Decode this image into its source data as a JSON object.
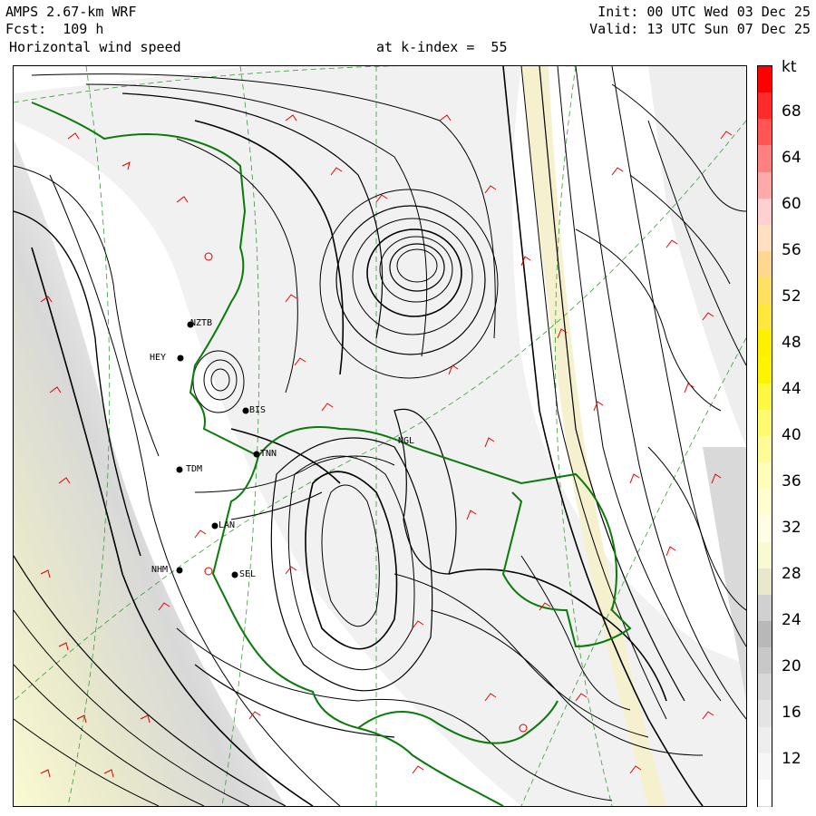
{
  "header": {
    "model": "AMPS 2.67-km WRF",
    "forecast": "Fcst:  109 h",
    "field": "Horizontal wind speed",
    "level": "at k-index =  55",
    "init": "Init: 00 UTC Wed 03 Dec 25",
    "valid": "Valid: 13 UTC Sun 07 Dec 25"
  },
  "colorbar": {
    "unit": "kt",
    "ticks": [
      "68",
      "64",
      "60",
      "56",
      "52",
      "48",
      "44",
      "40",
      "36",
      "32",
      "28",
      "24",
      "20",
      "16",
      "12"
    ],
    "colors": [
      "#ff0000",
      "#ff2a2a",
      "#ff5555",
      "#ff8080",
      "#ffaaaa",
      "#ffd0d0",
      "#ffe0c0",
      "#ffd890",
      "#ffe060",
      "#ffe83a",
      "#fff000",
      "#fff400",
      "#fff840",
      "#fffa70",
      "#fffc98",
      "#fffdb8",
      "#fffed0",
      "#fffee4",
      "#fafad2",
      "#e8e8cc",
      "#d0d0d0",
      "#b8b8b8",
      "#c8c8c8",
      "#d8d8d8",
      "#e4e4e4",
      "#eeeeee",
      "#f6f6f6",
      "#ffffff"
    ]
  },
  "stations": [
    {
      "label": "NZTB"
    },
    {
      "label": "HEY"
    },
    {
      "label": "BIS"
    },
    {
      "label": "TDM"
    },
    {
      "label": "LAN"
    },
    {
      "label": "NHM"
    },
    {
      "label": "SEL"
    },
    {
      "label": "NGL"
    },
    {
      "label": "TNN"
    }
  ]
}
